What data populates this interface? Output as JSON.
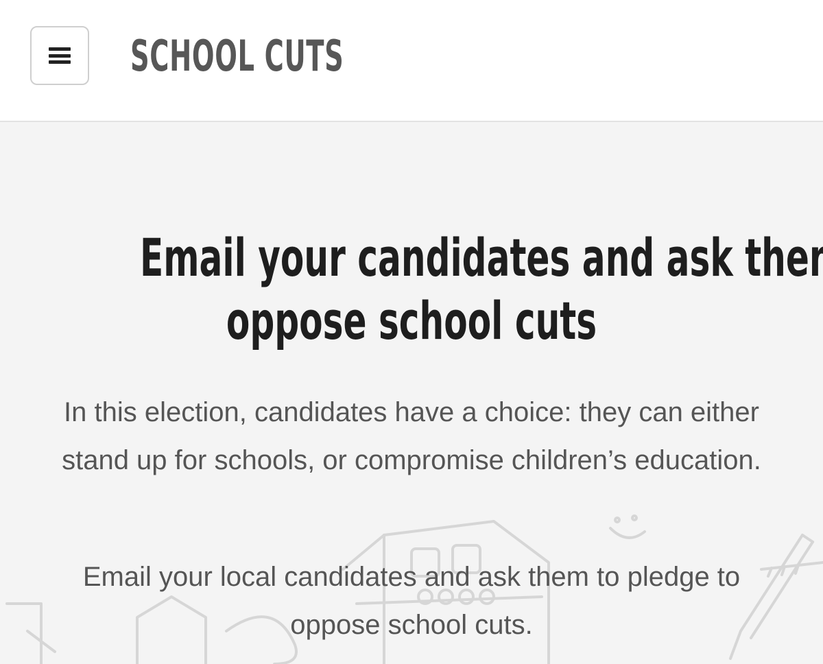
{
  "header": {
    "logo_text": "SCHOOL CUTS",
    "menu_icon": "hamburger-menu-icon"
  },
  "main": {
    "headline_line1": "Email your candidates and ask them to",
    "headline_line2": "oppose school cuts",
    "paragraph1": "In this election, candidates have a choice: they can either stand up for schools, or compromise children’s education.",
    "paragraph2": "Email your local candidates and ask them to pledge to oppose school cuts."
  },
  "colors": {
    "header_bg": "#ffffff",
    "page_bg": "#f4f4f4",
    "headline": "#1e1e1e",
    "body_text": "#555555",
    "logo": "#575757"
  }
}
